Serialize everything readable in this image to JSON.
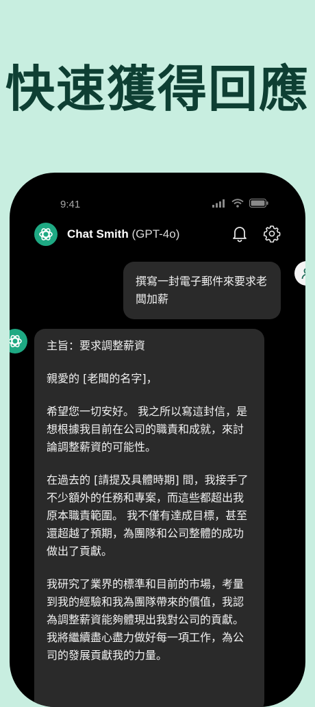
{
  "headline": "快速獲得回應",
  "status_bar": {
    "time": "9:41"
  },
  "header": {
    "name": "Chat Smith",
    "model": "(GPT-4o)"
  },
  "user_message": "撰寫一封電子郵件來要求老闆加薪",
  "bot_message": {
    "paragraphs": [
      "主旨：要求調整薪資",
      "親愛的 [老闆的名字]，",
      "希望您一切安好。 我之所以寫這封信，是想根據我目前在公司的職責和成就，來討論調整薪資的可能性。",
      "在過去的 [請提及具體時期] 間，我接手了不少額外的任務和專案，而這些都超出我原本職責範圍。 我不僅有達成目標，甚至還超越了預期，為團隊和公司整體的成功做出了貢獻。",
      "我研究了業界的標準和目前的市場，考量到我的經驗和我為團隊帶來的價值，我認為調整薪資能夠體現出我對公司的貢獻。 我將繼續盡心盡力做好每一項工作，為公司的發展貢獻我的力量。"
    ]
  },
  "colors": {
    "background": "#c8eee0",
    "headline": "#0e3f33",
    "accent": "#1ea983",
    "bubble": "#2a2a2a"
  },
  "icons": [
    "openai-logo-icon",
    "bell-icon",
    "gear-icon",
    "user-icon",
    "signal-icon",
    "wifi-icon",
    "battery-icon"
  ]
}
